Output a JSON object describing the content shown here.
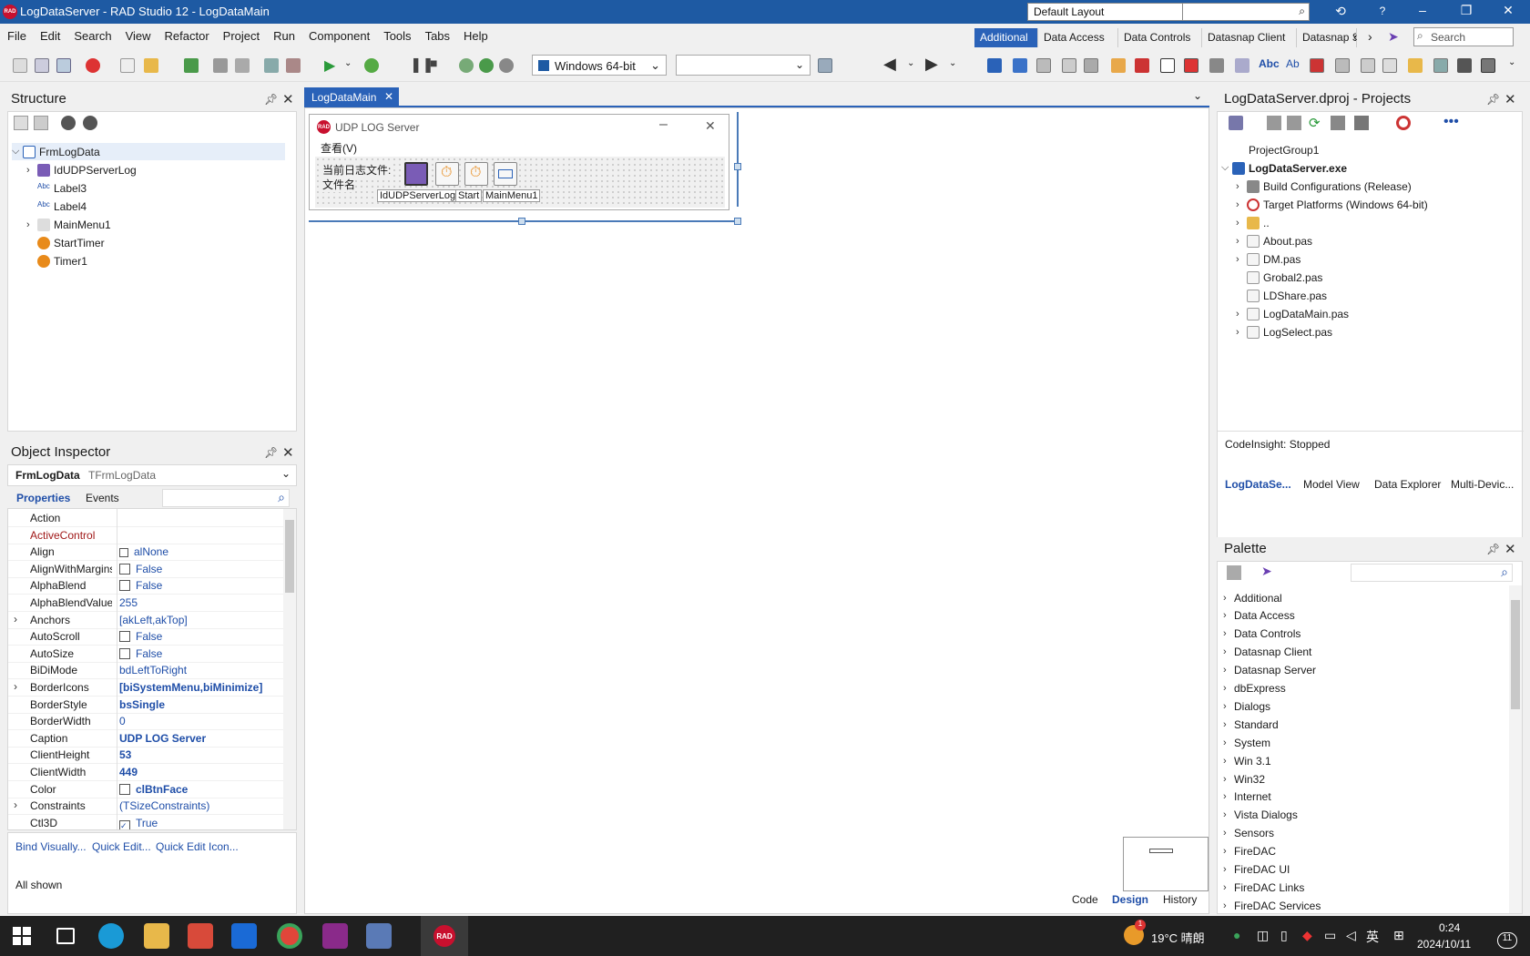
{
  "window": {
    "title": "LogDataServer - RAD Studio 12 - LogDataMain",
    "logo": "RAD",
    "layout_select": "Default Layout"
  },
  "menu": [
    "File",
    "Edit",
    "Search",
    "View",
    "Refactor",
    "Project",
    "Run",
    "Component",
    "Tools",
    "Tabs",
    "Help"
  ],
  "toolbar": {
    "platform": "Windows 64-bit",
    "search_placeholder": "Search"
  },
  "palette_tabs": [
    "Additional",
    "Data Access",
    "Data Controls",
    "Datasnap Client",
    "Datasnap Se"
  ],
  "structure": {
    "title": "Structure",
    "items": [
      {
        "label": "FrmLogData",
        "level": 0,
        "exp": "open"
      },
      {
        "label": "IdUDPServerLog",
        "level": 1,
        "exp": "closed"
      },
      {
        "label": "Label3",
        "level": 1,
        "exp": ""
      },
      {
        "label": "Label4",
        "level": 1,
        "exp": ""
      },
      {
        "label": "MainMenu1",
        "level": 1,
        "exp": "closed"
      },
      {
        "label": "StartTimer",
        "level": 1,
        "exp": ""
      },
      {
        "label": "Timer1",
        "level": 1,
        "exp": ""
      }
    ]
  },
  "inspector": {
    "title": "Object Inspector",
    "object_name": "FrmLogData",
    "object_type": "TFrmLogData",
    "tab_properties": "Properties",
    "tab_events": "Events",
    "rows": [
      {
        "name": "Action",
        "value": "",
        "cb": false,
        "bold": false,
        "exp": false
      },
      {
        "name": "ActiveControl",
        "value": "",
        "cb": false,
        "bold": false,
        "exp": false,
        "red": true
      },
      {
        "name": "Align",
        "value": "alNone",
        "cb": false,
        "bold": false,
        "exp": false,
        "icon": true
      },
      {
        "name": "AlignWithMargins",
        "value": "False",
        "cb": true,
        "bold": false,
        "exp": false
      },
      {
        "name": "AlphaBlend",
        "value": "False",
        "cb": true,
        "bold": false,
        "exp": false
      },
      {
        "name": "AlphaBlendValue",
        "value": "255",
        "cb": false,
        "bold": false,
        "exp": false
      },
      {
        "name": "Anchors",
        "value": "[akLeft,akTop]",
        "cb": false,
        "bold": false,
        "exp": true
      },
      {
        "name": "AutoScroll",
        "value": "False",
        "cb": true,
        "bold": false,
        "exp": false
      },
      {
        "name": "AutoSize",
        "value": "False",
        "cb": true,
        "bold": false,
        "exp": false
      },
      {
        "name": "BiDiMode",
        "value": "bdLeftToRight",
        "cb": false,
        "bold": false,
        "exp": false
      },
      {
        "name": "BorderIcons",
        "value": "[biSystemMenu,biMinimize]",
        "cb": false,
        "bold": true,
        "exp": true
      },
      {
        "name": "BorderStyle",
        "value": "bsSingle",
        "cb": false,
        "bold": true,
        "exp": false
      },
      {
        "name": "BorderWidth",
        "value": "0",
        "cb": false,
        "bold": false,
        "exp": false
      },
      {
        "name": "Caption",
        "value": "UDP LOG Server",
        "cb": false,
        "bold": true,
        "exp": false
      },
      {
        "name": "ClientHeight",
        "value": "53",
        "cb": false,
        "bold": true,
        "exp": false
      },
      {
        "name": "ClientWidth",
        "value": "449",
        "cb": false,
        "bold": true,
        "exp": false
      },
      {
        "name": "Color",
        "value": "clBtnFace",
        "cb": true,
        "bold": true,
        "exp": false
      },
      {
        "name": "Constraints",
        "value": "(TSizeConstraints)",
        "cb": false,
        "bold": false,
        "exp": true
      },
      {
        "name": "Ctl3D",
        "value": "True",
        "cb": true,
        "bold": false,
        "exp": false
      }
    ],
    "links": [
      "Bind Visually...",
      "Quick Edit...",
      "Quick Edit Icon..."
    ],
    "status": "All shown"
  },
  "designer": {
    "tab": "LogDataMain",
    "form_caption": "UDP LOG Server",
    "form_menu": "查看(V)",
    "label_current": "当前日志文件:",
    "label_filename": "文件名",
    "component_labels": [
      "IdUDPServerLog",
      "Start",
      "MainMenu1"
    ],
    "bottom_tabs": [
      "Code",
      "Design",
      "History"
    ]
  },
  "projects": {
    "title": "LogDataServer.dproj - Projects",
    "items": [
      {
        "label": "ProjectGroup1",
        "level": 0,
        "exp": "",
        "bold": false
      },
      {
        "label": "LogDataServer.exe",
        "level": 0,
        "exp": "open",
        "bold": true
      },
      {
        "label": "Build Configurations (Release)",
        "level": 1,
        "exp": "closed",
        "bold": false
      },
      {
        "label": "Target Platforms (Windows 64-bit)",
        "level": 1,
        "exp": "closed",
        "bold": false
      },
      {
        "label": "..",
        "level": 1,
        "exp": "closed",
        "bold": false
      },
      {
        "label": "About.pas",
        "level": 1,
        "exp": "closed",
        "bold": false
      },
      {
        "label": "DM.pas",
        "level": 1,
        "exp": "closed",
        "bold": false
      },
      {
        "label": "Grobal2.pas",
        "level": 1,
        "exp": "",
        "bold": false
      },
      {
        "label": "LDShare.pas",
        "level": 1,
        "exp": "",
        "bold": false
      },
      {
        "label": "LogDataMain.pas",
        "level": 1,
        "exp": "closed",
        "bold": false
      },
      {
        "label": "LogSelect.pas",
        "level": 1,
        "exp": "closed",
        "bold": false
      }
    ],
    "codeinsight": "CodeInsight: Stopped",
    "tabs": [
      "LogDataSe...",
      "Model View",
      "Data Explorer",
      "Multi-Devic..."
    ]
  },
  "palette": {
    "title": "Palette",
    "items": [
      "Additional",
      "Data Access",
      "Data Controls",
      "Datasnap Client",
      "Datasnap Server",
      "dbExpress",
      "Dialogs",
      "Standard",
      "System",
      "Win 3.1",
      "Win32",
      "Internet",
      "Vista Dialogs",
      "Sensors",
      "FireDAC",
      "FireDAC UI",
      "FireDAC Links",
      "FireDAC Services"
    ]
  },
  "taskbar": {
    "weather": "19°C 晴朗",
    "ime": "英",
    "time": "0:24",
    "date": "2024/10/11",
    "notif_badge": "1",
    "notif_count": "11"
  },
  "colors": {
    "accent": "#1e5aa3",
    "active_tab": "#2a62b8",
    "link": "#1f4ea8"
  }
}
